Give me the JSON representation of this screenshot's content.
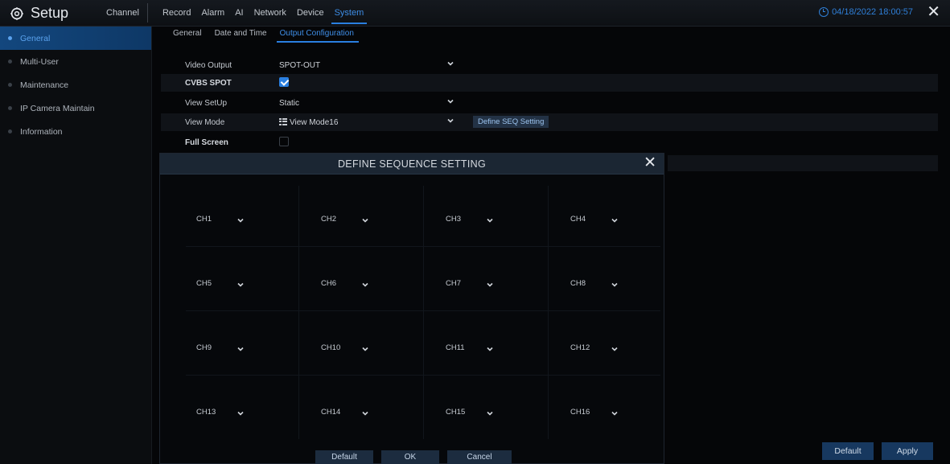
{
  "app": {
    "title": "Setup"
  },
  "top_nav": [
    "Channel",
    "Record",
    "Alarm",
    "AI",
    "Network",
    "Device",
    "System"
  ],
  "top_nav_active": "System",
  "clock": "04/18/2022 18:00:57",
  "sidebar": {
    "items": [
      {
        "label": "General"
      },
      {
        "label": "Multi-User"
      },
      {
        "label": "Maintenance"
      },
      {
        "label": "IP Camera Maintain"
      },
      {
        "label": "Information"
      }
    ]
  },
  "sub_tabs": [
    "General",
    "Date and Time",
    "Output Configuration"
  ],
  "settings": {
    "video_output": {
      "label": "Video Output",
      "value": "SPOT-OUT"
    },
    "cvbs_spot": {
      "label": "CVBS SPOT",
      "checked": true
    },
    "view_setup": {
      "label": "View SetUp",
      "value": "Static"
    },
    "view_mode": {
      "label": "View Mode",
      "value": "View Mode16"
    },
    "define_seq_button": "Define SEQ Setting",
    "full_screen": {
      "label": "Full Screen",
      "checked": false
    }
  },
  "dialog": {
    "title": "DEFINE SEQUENCE SETTING",
    "channels": [
      "CH1",
      "CH2",
      "CH3",
      "CH4",
      "CH5",
      "CH6",
      "CH7",
      "CH8",
      "CH9",
      "CH10",
      "CH11",
      "CH12",
      "CH13",
      "CH14",
      "CH15",
      "CH16"
    ],
    "buttons": {
      "default": "Default",
      "ok": "OK",
      "cancel": "Cancel"
    }
  },
  "footer": {
    "default": "Default",
    "apply": "Apply"
  },
  "colors": {
    "accent": "#2a7fe0",
    "active_sidebar": "#13477e",
    "background": "#050608"
  }
}
